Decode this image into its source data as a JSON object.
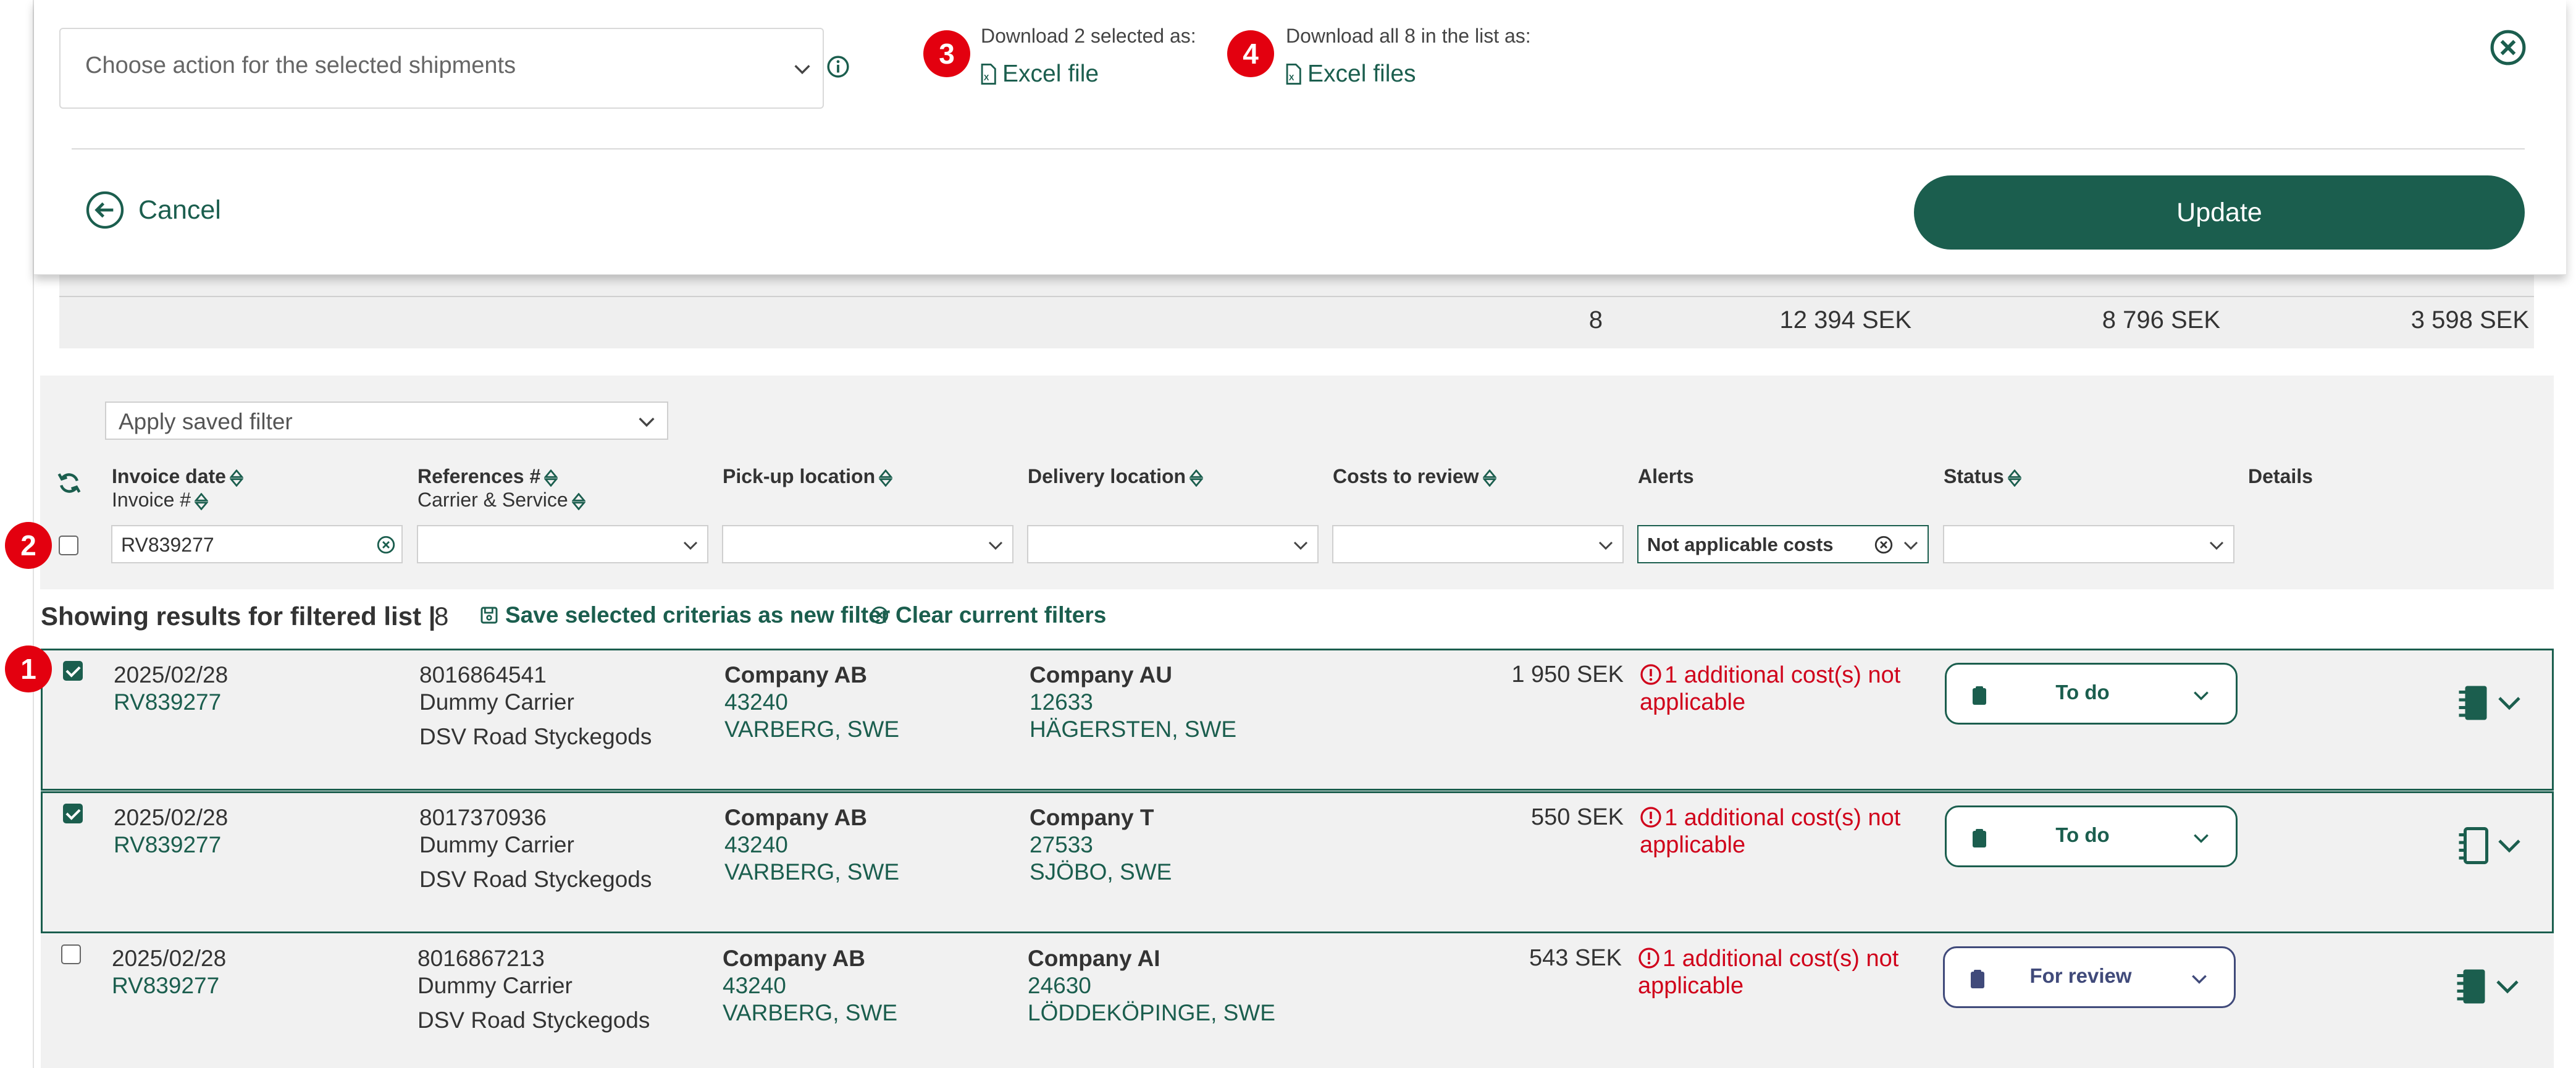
{
  "action_panel": {
    "action_placeholder": "Choose action for the selected shipments",
    "download_selected": {
      "badge": "3",
      "caption": "Download 2 selected as:",
      "link": "Excel file"
    },
    "download_all": {
      "badge": "4",
      "caption": "Download all 8 in the list as:",
      "link": "Excel files"
    },
    "cancel_label": "Cancel",
    "update_label": "Update"
  },
  "totals": {
    "shipments": "8",
    "total_cost": "12 394 SEK",
    "col2": "8 796 SEK",
    "col3": "3 598 SEK"
  },
  "filters": {
    "saved_filter_placeholder": "Apply saved filter",
    "row_badge": "2",
    "invoice_filter_value": "RV839277",
    "alerts_filter_value": "Not applicable costs"
  },
  "columns": {
    "invoice": {
      "main": "Invoice date",
      "sub": "Invoice #"
    },
    "references": {
      "main": "References #",
      "sub": "Carrier & Service"
    },
    "pickup": "Pick-up location",
    "delivery": "Delivery location",
    "costs": "Costs to review",
    "alerts": "Alerts",
    "status": "Status",
    "details": "Details"
  },
  "results": {
    "title": "Showing results for filtered list |",
    "count": "8",
    "save_filter_label": "Save selected criterias as new filter",
    "clear_filter_label": "Clear current filters",
    "first_row_badge": "1"
  },
  "rows": [
    {
      "selected": true,
      "date": "2025/02/28",
      "invoice": "RV839277",
      "reference": "8016864541",
      "carrier": "Dummy Carrier",
      "service": "DSV Road Styckegods",
      "pickup_company": "Company AB",
      "pickup_zip": "43240",
      "pickup_city": "VARBERG, SWE",
      "delivery_company": "Company AU",
      "delivery_zip": "12633",
      "delivery_city": "HÄGERSTEN, SWE",
      "cost": "1 950 SEK",
      "alert_l1": "1 additional cost(s) not",
      "alert_l2": "applicable",
      "status": "To do"
    },
    {
      "selected": true,
      "date": "2025/02/28",
      "invoice": "RV839277",
      "reference": "8017370936",
      "carrier": "Dummy Carrier",
      "service": "DSV Road Styckegods",
      "pickup_company": "Company AB",
      "pickup_zip": "43240",
      "pickup_city": "VARBERG, SWE",
      "delivery_company": "Company T",
      "delivery_zip": "27533",
      "delivery_city": "SJÖBO, SWE",
      "cost": "550 SEK",
      "alert_l1": "1 additional cost(s) not",
      "alert_l2": "applicable",
      "status": "To do"
    },
    {
      "selected": false,
      "date": "2025/02/28",
      "invoice": "RV839277",
      "reference": "8016867213",
      "carrier": "Dummy Carrier",
      "service": "DSV Road Styckegods",
      "pickup_company": "Company AB",
      "pickup_zip": "43240",
      "pickup_city": "VARBERG, SWE",
      "delivery_company": "Company AI",
      "delivery_zip": "24630",
      "delivery_city": "LÖDDEKÖPINGE, SWE",
      "cost": "543 SEK",
      "alert_l1": "1 additional cost(s) not",
      "alert_l2": "applicable",
      "status": "For review"
    }
  ],
  "colors": {
    "brand": "#1b5e4e",
    "alert": "#d0021b",
    "badge": "#e3000f",
    "review": "#404a7a"
  },
  "icons": [
    "chevron-down-icon",
    "info-icon",
    "excel-file-icon",
    "close-icon",
    "back-arrow-icon",
    "refresh-icon",
    "sort-icon",
    "clear-icon",
    "save-icon",
    "alert-icon",
    "clipboard-icon",
    "details-doc-icon"
  ]
}
